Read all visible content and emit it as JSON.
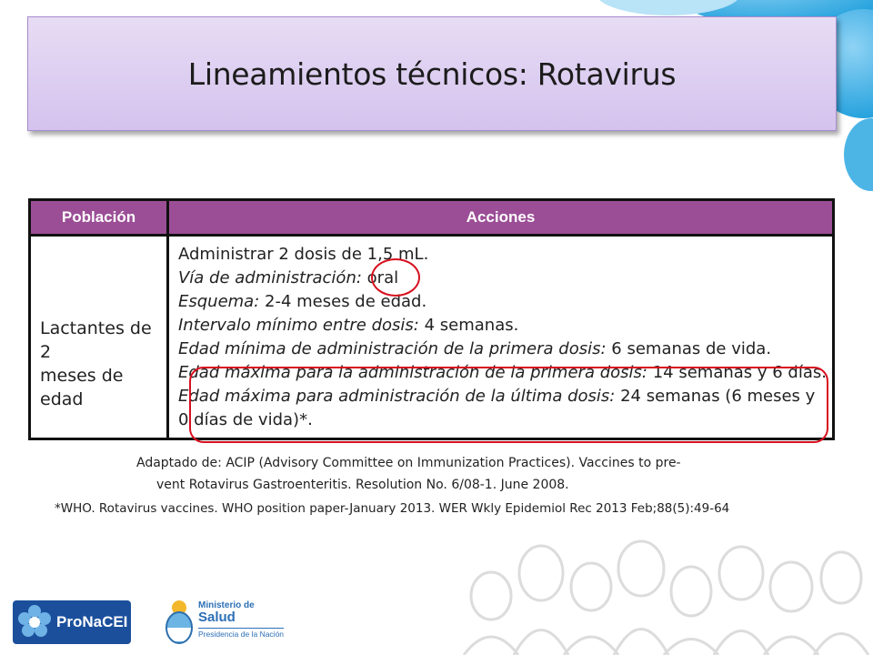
{
  "title": "Lineamientos técnicos: Rotavirus",
  "table": {
    "headers": [
      "Población",
      "Acciones"
    ],
    "population": [
      "Lactantes de 2",
      "meses de edad"
    ],
    "actions": [
      {
        "label": "",
        "text": "Administrar 2 dosis de 1,5 mL."
      },
      {
        "label": "Vía de administración:",
        "text": "oral"
      },
      {
        "label": "Esquema:",
        "text": "2-4 meses de edad."
      },
      {
        "label": "Intervalo mínimo entre dosis:",
        "text": "4 semanas."
      },
      {
        "label": "Edad mínima de administración de la primera dosis:",
        "text": "6 semanas de vida."
      },
      {
        "label": "Edad máxima para la administración de la primera dosis:",
        "text": "14 semanas y 6 días."
      },
      {
        "label": "Edad máxima para administración de la última dosis:",
        "text": "24 semanas (6 meses y"
      },
      {
        "label": "",
        "text": "0 días de vida)*."
      }
    ]
  },
  "references": {
    "line1": "Adaptado de: ACIP (Advisory Committee on Immunization Practices). Vaccines to pre-",
    "line2": "vent Rotavirus Gastroenteritis. Resolution No. 6/08-1. June 2008.",
    "line3": "*WHO. Rotavirus vaccines. WHO position paper-January 2013. WER Wkly Epidemiol Rec 2013 Feb;88(5):49-64"
  },
  "logos": {
    "pronacei": "ProNaCEI",
    "ministerio_line1": "Ministerio de",
    "ministerio_line2": "Salud",
    "ministerio_line3": "Presidencia de la Nación"
  },
  "colors": {
    "header_purple": "#9b4e96",
    "title_box": "#dccdf1",
    "highlight_red": "#d8101e",
    "logo_blue": "#1b4f9c"
  }
}
